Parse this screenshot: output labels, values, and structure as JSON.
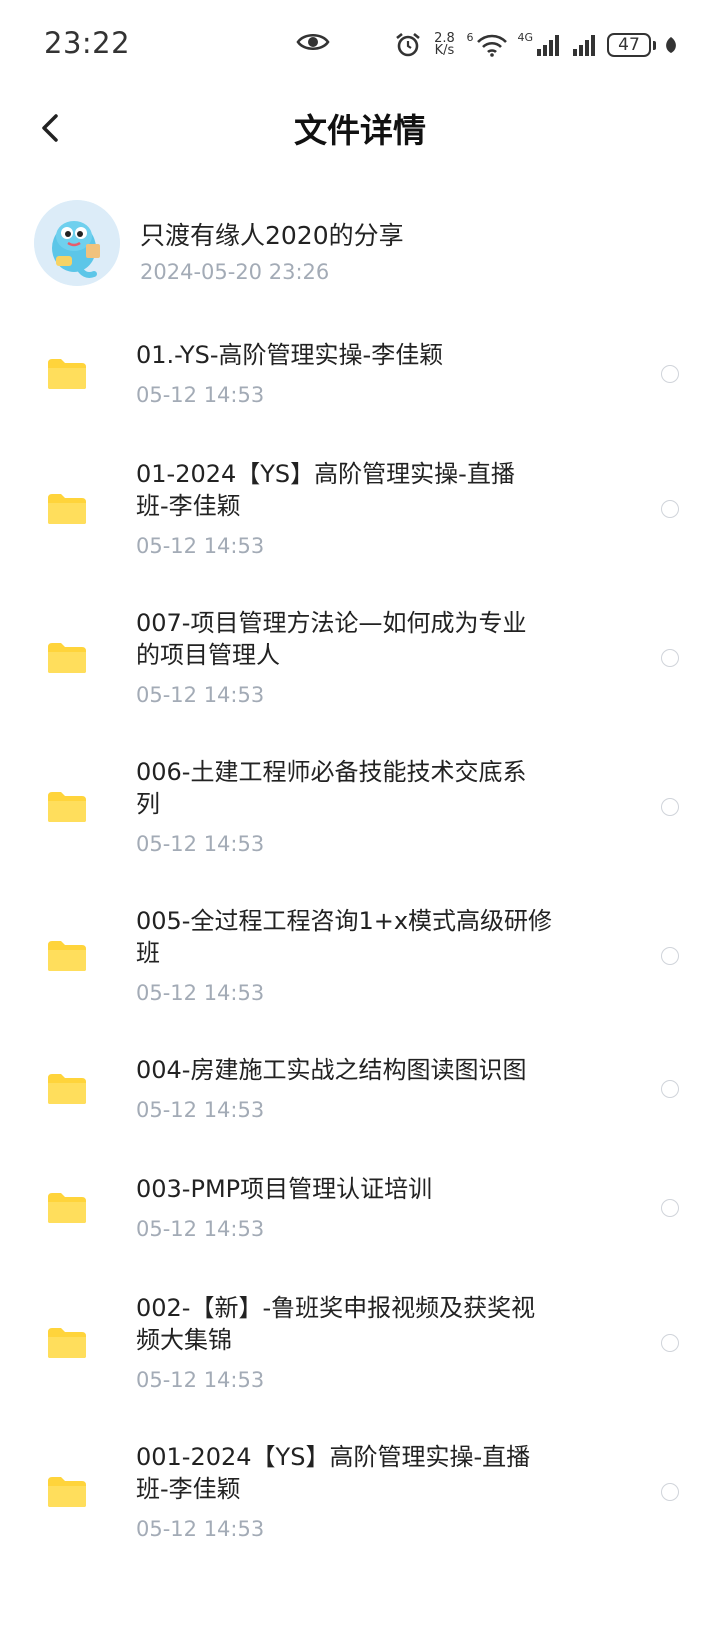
{
  "status": {
    "time": "23:22",
    "net_speed_top": "2.8",
    "net_speed_bottom": "K/s",
    "wifi_tag": "6",
    "net_type": "4G",
    "battery": "47"
  },
  "header": {
    "title": "文件详情"
  },
  "share": {
    "sharer": "只渡有缘人2020的分享",
    "time": "2024-05-20  23:26"
  },
  "files": [
    {
      "line1": "01.-YS-高阶管理实操-李佳颖",
      "line2": "",
      "time": "05-12  14:53"
    },
    {
      "line1": "01-2024【YS】高阶管理实操-直播",
      "line2": "班-李佳颖",
      "time": "05-12  14:53"
    },
    {
      "line1": "007-项目管理方法论—如何成为专业",
      "line2": "的项目管理人",
      "time": "05-12  14:53"
    },
    {
      "line1": "006-土建工程师必备技能技术交底系",
      "line2": "列",
      "time": "05-12  14:53"
    },
    {
      "line1": "005-全过程工程咨询1+x模式高级研修",
      "line2": "班",
      "time": "05-12  14:53"
    },
    {
      "line1": "004-房建施工实战之结构图读图识图",
      "line2": "",
      "time": "05-12  14:53"
    },
    {
      "line1": "003-PMP项目管理认证培训",
      "line2": "",
      "time": "05-12  14:53"
    },
    {
      "line1": "002-【新】-鲁班奖申报视频及获奖视",
      "line2": "频大集锦",
      "time": "05-12  14:53"
    },
    {
      "line1": "001-2024【YS】高阶管理实操-直播",
      "line2": "班-李佳颖",
      "time": "05-12  14:53"
    }
  ],
  "colors": {
    "folder": "#ffd43b",
    "secondary_text": "#a3abb6"
  }
}
